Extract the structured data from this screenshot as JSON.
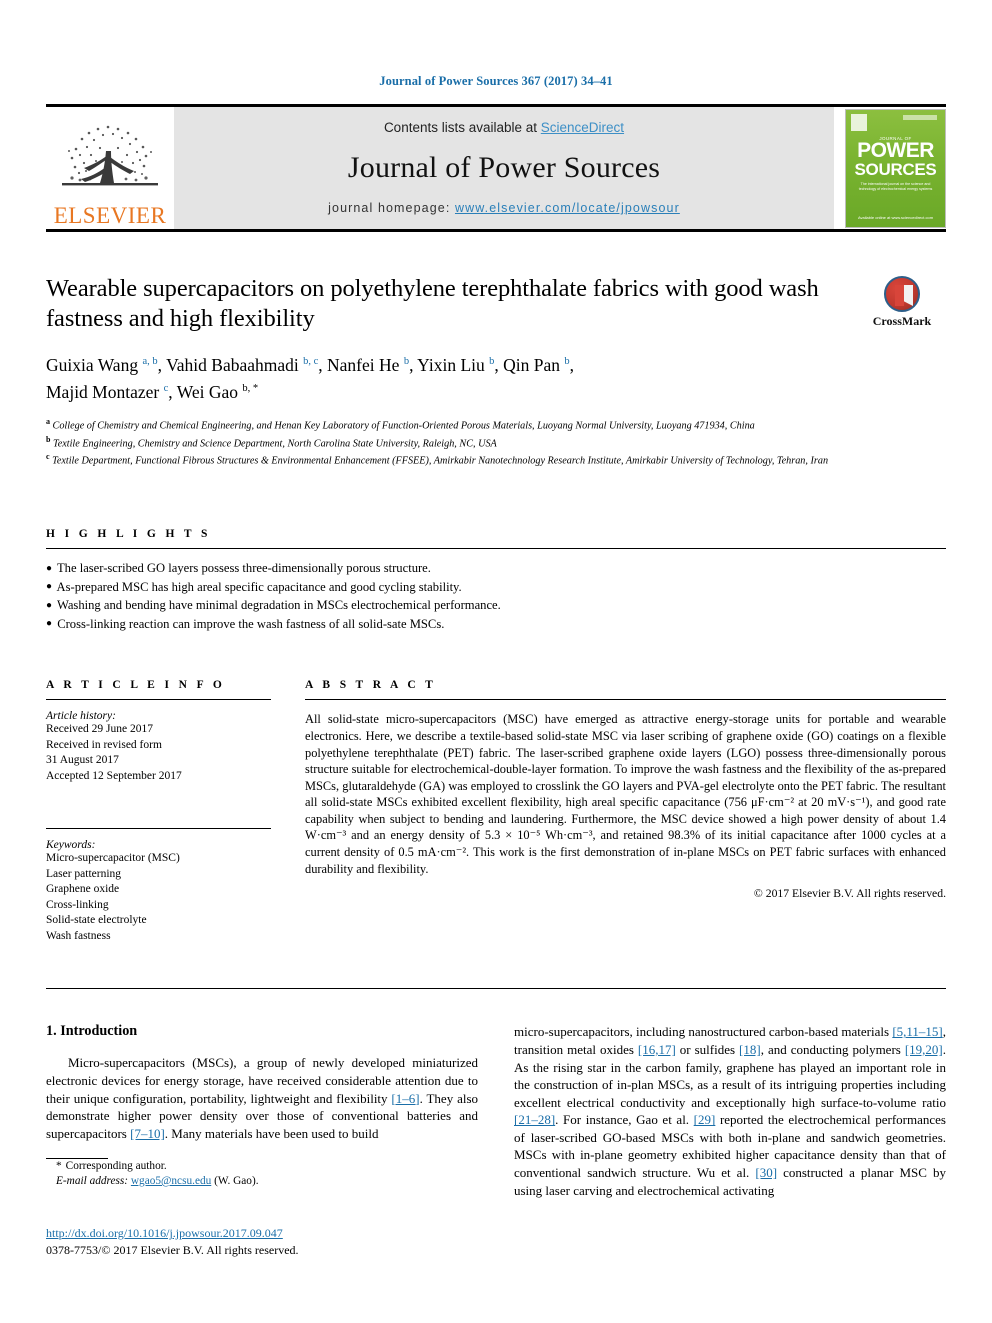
{
  "running_head": "Journal of Power Sources 367 (2017) 34–41",
  "masthead": {
    "publisher_logo_text": "ELSEVIER",
    "contents_prefix": "Contents lists available at ",
    "contents_link": "ScienceDirect",
    "journal_name": "Journal of Power Sources",
    "homepage_prefix": "journal homepage: ",
    "homepage_url": "www.elsevier.com/locate/jpowsour",
    "cover": {
      "sub": "JOURNAL OF",
      "power": "POWER",
      "sources": "SOURCES",
      "blurb": "The international journal on the science and technology of electrochemical energy systems",
      "foot": "Available online at www.sciencedirect.com",
      "accent_color": "#79b330"
    }
  },
  "article": {
    "title": "Wearable supercapacitors on polyethylene terephthalate fabrics with good wash fastness and high flexibility",
    "crossmark_label": "CrossMark",
    "authors_line_1_parts": [
      {
        "name": "Guixia Wang",
        "sup": "a, b",
        "sep": ", "
      },
      {
        "name": "Vahid Babaahmadi",
        "sup": "b, c",
        "sep": ", "
      },
      {
        "name": "Nanfei He",
        "sup": "b",
        "sep": ", "
      },
      {
        "name": "Yixin Liu",
        "sup": "b",
        "sep": ", "
      },
      {
        "name": "Qin Pan",
        "sup": "b",
        "sep": ","
      }
    ],
    "authors_line_2_parts": [
      {
        "name": "Majid Montazer",
        "sup": "c",
        "sep": ", "
      },
      {
        "name": "Wei Gao",
        "sup": "b, *",
        "sep": ""
      }
    ],
    "affiliations": [
      {
        "mark": "a",
        "text": "College of Chemistry and Chemical Engineering, and Henan Key Laboratory of Function-Oriented Porous Materials, Luoyang Normal University, Luoyang 471934, China"
      },
      {
        "mark": "b",
        "text": "Textile Engineering, Chemistry and Science Department, North Carolina State University, Raleigh, NC, USA"
      },
      {
        "mark": "c",
        "text": "Textile Department, Functional Fibrous Structures & Environmental Enhancement (FFSEE), Amirkabir Nanotechnology Research Institute, Amirkabir University of Technology, Tehran, Iran"
      }
    ]
  },
  "highlights": {
    "heading": "H I G H L I G H T S",
    "items": [
      "The laser-scribed GO layers possess three-dimensionally porous structure.",
      "As-prepared MSC has high areal specific capacitance and good cycling stability.",
      "Washing and bending have minimal degradation in MSCs electrochemical performance.",
      "Cross-linking reaction can improve the wash fastness of all solid-sate MSCs."
    ]
  },
  "article_info": {
    "heading": "A R T I C L E   I N F O",
    "history_title": "Article history:",
    "history_lines": [
      "Received 29 June 2017",
      "Received in revised form",
      "31 August 2017",
      "Accepted 12 September 2017"
    ],
    "keywords_title": "Keywords:",
    "keywords": [
      "Micro-supercapacitor (MSC)",
      "Laser patterning",
      "Graphene oxide",
      "Cross-linking",
      "Solid-state electrolyte",
      "Wash fastness"
    ]
  },
  "abstract": {
    "heading": "A B S T R A C T",
    "text": "All solid-state micro-supercapacitors (MSC) have emerged as attractive energy-storage units for portable and wearable electronics. Here, we describe a textile-based solid-state MSC via laser scribing of graphene oxide (GO) coatings on a flexible polyethylene terephthalate (PET) fabric. The laser-scribed graphene oxide layers (LGO) possess three-dimensionally porous structure suitable for electrochemical-double-layer formation. To improve the wash fastness and the flexibility of the as-prepared MSCs, glutaraldehyde (GA) was employed to crosslink the GO layers and PVA-gel electrolyte onto the PET fabric. The resultant all solid-state MSCs exhibited excellent flexibility, high areal specific capacitance (756 μF·cm⁻² at 20 mV·s⁻¹), and good rate capability when subject to bending and laundering. Furthermore, the MSC device showed a high power density of about 1.4 W·cm⁻³ and an energy density of 5.3 × 10⁻⁵ Wh·cm⁻³, and retained 98.3% of its initial capacitance after 1000 cycles at a current density of 0.5 mA·cm⁻². This work is the first demonstration of in-plane MSCs on PET fabric surfaces with enhanced durability and flexibility.",
    "copyright": "© 2017 Elsevier B.V. All rights reserved."
  },
  "introduction": {
    "heading": "1.  Introduction",
    "left_paragraph_segments": [
      {
        "t": "Micro-supercapacitors (MSCs), a group of newly developed miniaturized electronic devices for energy storage, have received considerable attention due to their unique configuration, portability, lightweight and flexibility "
      },
      {
        "t": "[1–6]",
        "ref": true
      },
      {
        "t": ". They also demonstrate higher power density over those of conventional batteries and supercapacitors "
      },
      {
        "t": "[7–10]",
        "ref": true
      },
      {
        "t": ". Many materials have been used to build"
      }
    ],
    "right_paragraph_segments": [
      {
        "t": "micro-supercapacitors, including nanostructured carbon-based materials "
      },
      {
        "t": "[5,11–15]",
        "ref": true
      },
      {
        "t": ", transition metal oxides "
      },
      {
        "t": "[16,17]",
        "ref": true
      },
      {
        "t": " or sulfides "
      },
      {
        "t": "[18]",
        "ref": true
      },
      {
        "t": ", and conducting polymers "
      },
      {
        "t": "[19,20]",
        "ref": true
      },
      {
        "t": ". As the rising star in the carbon family, graphene has played an important role in the construction of in-plan MSCs, as a result of its intriguing properties including excellent electrical conductivity and exceptionally high surface-to-volume ratio "
      },
      {
        "t": "[21–28]",
        "ref": true
      },
      {
        "t": ". For instance, Gao et al. "
      },
      {
        "t": "[29]",
        "ref": true
      },
      {
        "t": " reported the electrochemical performances of laser-scribed GO-based MSCs with both in-plane and sandwich geometries. MSCs with in-plane geometry exhibited higher capacitance density than that of conventional sandwich structure. Wu et al. "
      },
      {
        "t": "[30]",
        "ref": true
      },
      {
        "t": " constructed a planar MSC by using laser carving and electrochemical activating"
      }
    ]
  },
  "footnote": {
    "star": "*",
    "corresponding": "Corresponding author.",
    "email_label": "E-mail address:",
    "email": "wgao5@ncsu.edu",
    "email_suffix": " (W. Gao).",
    "doi": "http://dx.doi.org/10.1016/j.jpowsour.2017.09.047",
    "issn_line": "0378-7753/© 2017 Elsevier B.V. All rights reserved."
  }
}
